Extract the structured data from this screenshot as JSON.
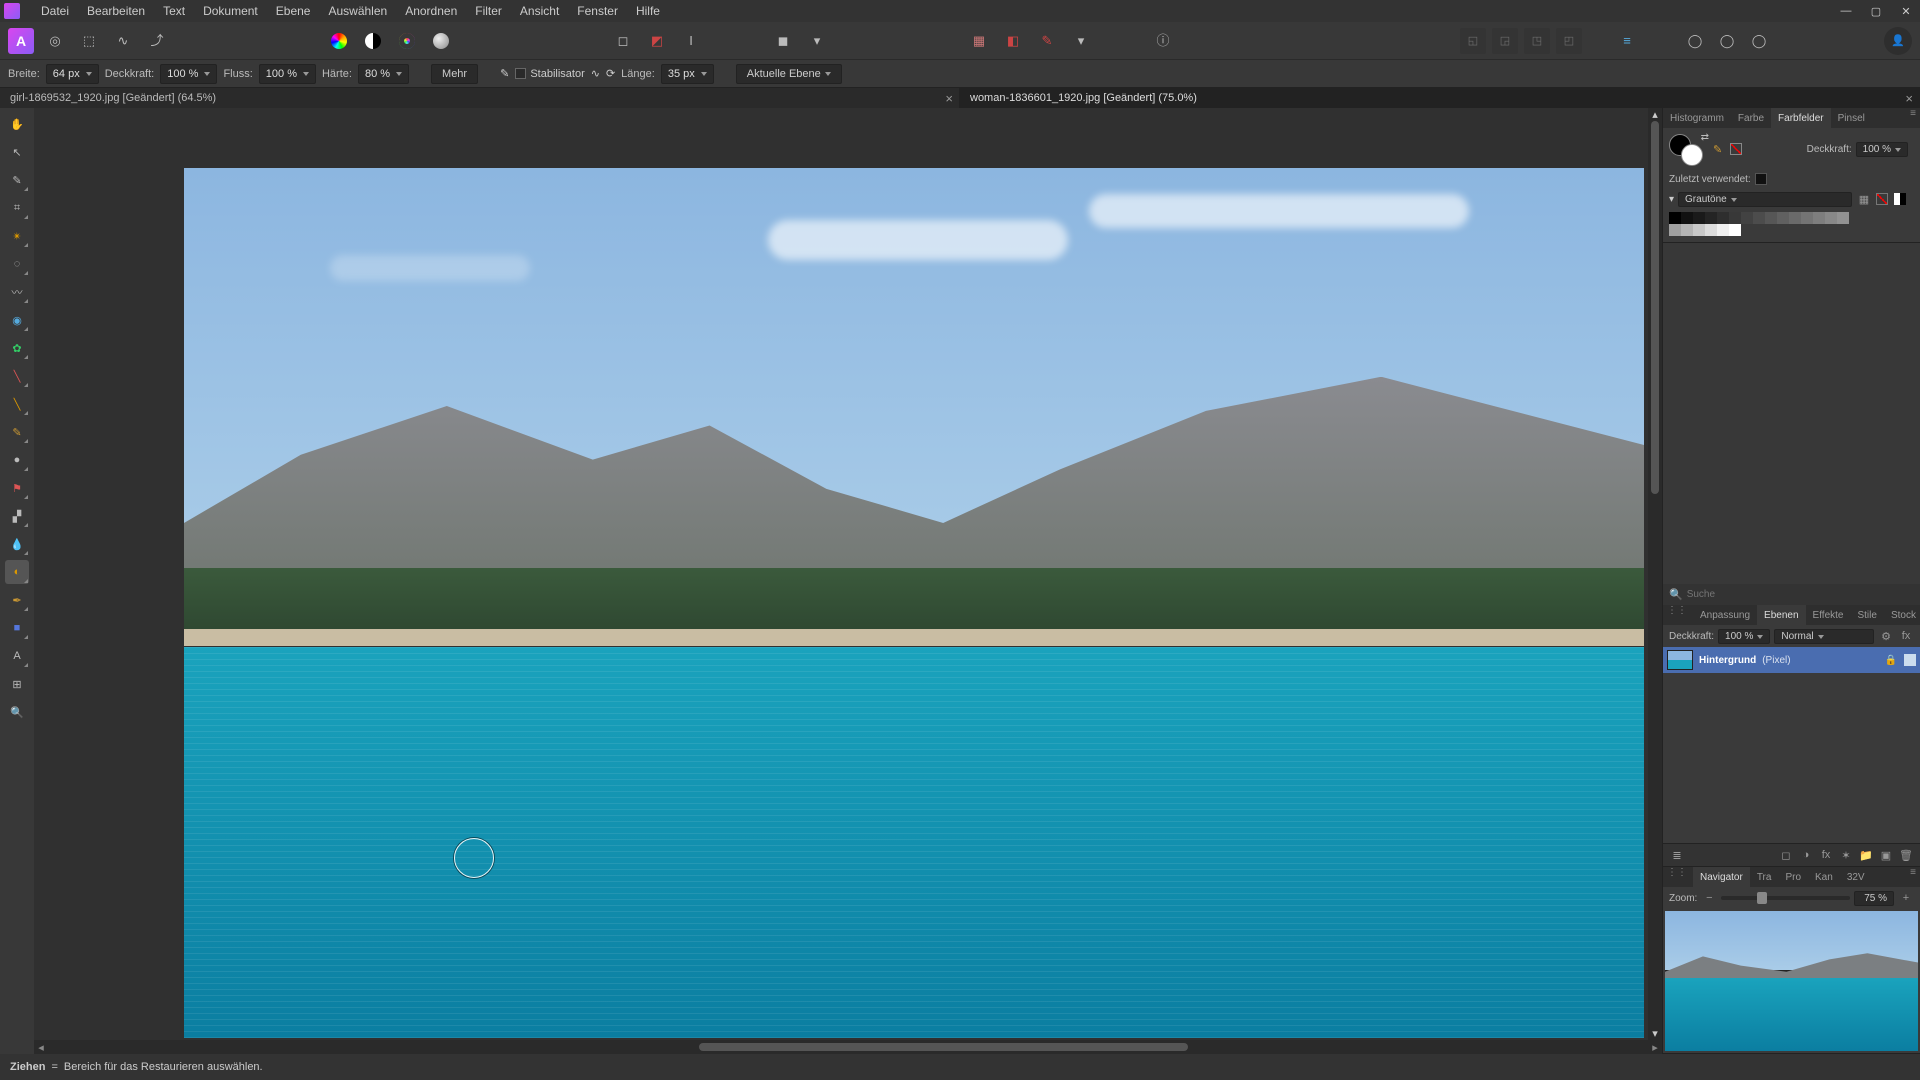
{
  "menu": [
    "Datei",
    "Bearbeiten",
    "Text",
    "Dokument",
    "Ebene",
    "Auswählen",
    "Anordnen",
    "Filter",
    "Ansicht",
    "Fenster",
    "Hilfe"
  ],
  "context": {
    "breite_label": "Breite:",
    "breite": "64 px",
    "deck_label": "Deckkraft:",
    "deck": "100 %",
    "fluss_label": "Fluss:",
    "fluss": "100 %",
    "harte_label": "Härte:",
    "harte": "80 %",
    "mehr": "Mehr",
    "stabil": "Stabilisator",
    "lange_label": "Länge:",
    "lange": "35 px",
    "target": "Aktuelle Ebene"
  },
  "tabs": [
    {
      "label": "girl-1869532_1920.jpg [Geändert] (64.5%)",
      "active": false
    },
    {
      "label": "woman-1836601_1920.jpg [Geändert] (75.0%)",
      "active": true
    }
  ],
  "right_top_tabs": [
    "Histogramm",
    "Farbe",
    "Farbfelder",
    "Pinsel"
  ],
  "right_top_active": "Farbfelder",
  "swatches": {
    "deck_label": "Deckkraft:",
    "deck": "100 %",
    "recent_label": "Zuletzt verwendet:",
    "palette_name": "Grautöne"
  },
  "layers_tabs": [
    "Anpassung",
    "Ebenen",
    "Effekte",
    "Stile",
    "Stock"
  ],
  "layers_active": "Ebenen",
  "layers": {
    "deck_label": "Deckkraft:",
    "deck": "100 %",
    "blend": "Normal",
    "items": [
      {
        "name": "Hintergrund",
        "type": "(Pixel)"
      }
    ],
    "search_placeholder": "Suche"
  },
  "nav_tabs": [
    "Navigator",
    "Tra",
    "Pro",
    "Kan",
    "32V"
  ],
  "nav_active": "Navigator",
  "nav": {
    "zoom_label": "Zoom:",
    "zoom": "75 %"
  },
  "status": {
    "action": "Ziehen",
    "sep": "=",
    "hint": "Bereich für das Restaurieren auswählen."
  }
}
